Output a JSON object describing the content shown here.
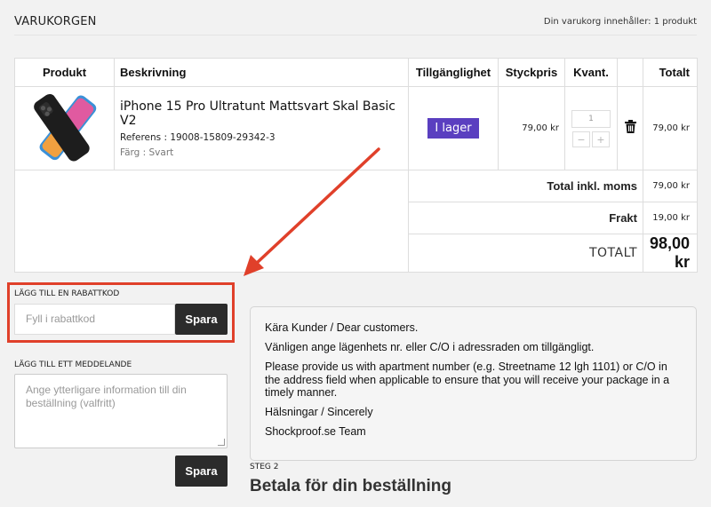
{
  "header": {
    "title": "VARUKORGEN",
    "cart_count": "Din varukorg innehåller: 1 produkt"
  },
  "table": {
    "columns": [
      "Produkt",
      "Beskrivning",
      "Tillgänglighet",
      "Styckpris",
      "Kvant.",
      "",
      "Totalt"
    ],
    "item": {
      "name": "iPhone 15 Pro Ultratunt Mattsvart Skal Basic V2",
      "reference": "Referens : 19008-15809-29342-3",
      "color": "Färg : Svart",
      "availability": "I lager",
      "unit_price": "79,00 kr",
      "quantity": "1",
      "total": "79,00 kr"
    },
    "summary": {
      "total_incl_vat_label": "Total inkl. moms",
      "total_incl_vat_value": "79,00 kr",
      "shipping_label": "Frakt",
      "shipping_value": "19,00 kr",
      "grand_total_label": "TOTALT",
      "grand_total_value": "98,00 kr"
    }
  },
  "discount": {
    "label": "LÄGG TILL EN RABATTKOD",
    "placeholder": "Fyll i rabattkod",
    "button": "Spara"
  },
  "message": {
    "label": "LÄGG TILL ETT MEDDELANDE",
    "placeholder": "Ange ytterligare information till din beställning (valfritt)",
    "button": "Spara"
  },
  "notice": {
    "lines": [
      "Kära Kunder / Dear customers.",
      "Vänligen ange lägenhets nr. eller C/O i adressraden om tillgängligt.",
      "Please provide us with apartment number (e.g. Streetname 12 lgh 1101) or C/O in the address field when applicable to ensure that you will receive your package in a timely manner.",
      "Hälsningar / Sincerely",
      "Shockproof.se Team"
    ]
  },
  "step": {
    "label": "STEG 2",
    "title": "Betala för din beställning"
  },
  "colors": {
    "stock_badge": "#5a3fc0",
    "highlight": "#e0402a",
    "dark_button": "#2b2b2b"
  }
}
